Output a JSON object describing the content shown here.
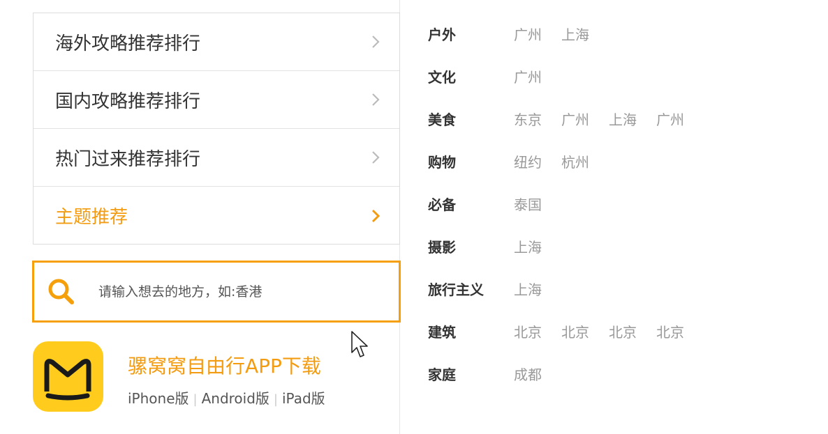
{
  "menu": {
    "items": [
      {
        "label": "海外攻略推荐排行",
        "active": false
      },
      {
        "label": "国内攻略推荐排行",
        "active": false
      },
      {
        "label": "热门过来推荐排行",
        "active": false
      },
      {
        "label": "主题推荐",
        "active": true
      }
    ]
  },
  "search": {
    "placeholder": "请输入想去的地方，如:香港"
  },
  "app": {
    "title": "骡窝窝自由行APP下载",
    "links": [
      "iPhone版",
      "Android版",
      "iPad版"
    ]
  },
  "categories": [
    {
      "name": "户外",
      "cities": [
        "广州",
        "上海"
      ]
    },
    {
      "name": "文化",
      "cities": [
        "广州"
      ]
    },
    {
      "name": "美食",
      "cities": [
        "东京",
        "广州",
        "上海",
        "广州"
      ]
    },
    {
      "name": "购物",
      "cities": [
        "纽约",
        "杭州"
      ]
    },
    {
      "name": "必备",
      "cities": [
        "泰国"
      ]
    },
    {
      "name": "摄影",
      "cities": [
        "上海"
      ]
    },
    {
      "name": "旅行主义",
      "cities": [
        "上海"
      ]
    },
    {
      "name": "建筑",
      "cities": [
        "北京",
        "北京",
        "北京",
        "北京"
      ]
    },
    {
      "name": "家庭",
      "cities": [
        "成都"
      ]
    }
  ],
  "colors": {
    "accent": "#f39c12",
    "search_border": "#f5a00a",
    "logo_bg": "#ffcc1e"
  },
  "icons": [
    "chevron-right-icon",
    "search-icon",
    "app-logo-icon",
    "mouse-cursor-icon"
  ]
}
